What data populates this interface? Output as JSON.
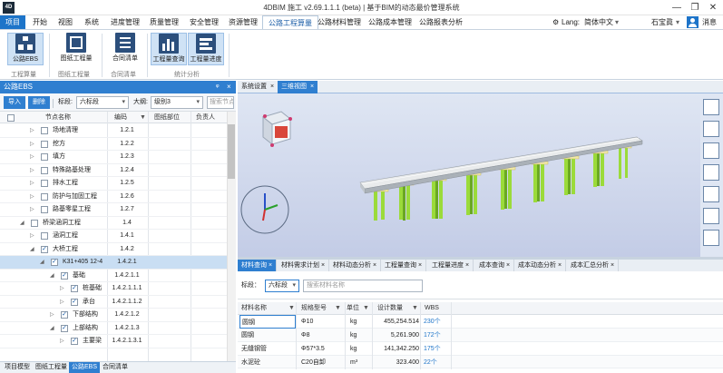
{
  "titlebar": {
    "app_icon_text": "4D",
    "title": "4DBIM 施工 v2.69.1.1.1  (beta)  |  基于BIM的动态最价管理系统",
    "min": "—",
    "max": "❐",
    "close": "✕"
  },
  "menu": {
    "items": [
      "项目",
      "开始",
      "视图",
      "系统",
      "进度管理",
      "质量管理",
      "安全管理",
      "资源管理",
      "公路工程算量",
      "公路材料管理",
      "公路成本管理",
      "公路报表分析"
    ],
    "lang_label": "Lang:",
    "lang_value": "简体中文",
    "user": "石宝眞",
    "message": "消息"
  },
  "ribbon": {
    "buttons": [
      "公路EBS",
      "图纸工程量",
      "合同清单",
      "工程量查询",
      "工程量进度"
    ],
    "groups": [
      "工程算量",
      "图纸工程量",
      "合同清单",
      "统计分析"
    ]
  },
  "left_panel": {
    "title": "公路EBS",
    "import": "导入",
    "delete": "删除",
    "section_label": "标段:",
    "section_value": "六标段",
    "level_label": "大纲:",
    "level_value": "级别3",
    "search_placeholder": "搜索节点",
    "columns": [
      "节点名称",
      "编码",
      "图纸部位",
      "负责人"
    ],
    "rows": [
      {
        "name": "场地清理",
        "code": "1.2.1"
      },
      {
        "name": "挖方",
        "code": "1.2.2"
      },
      {
        "name": "填方",
        "code": "1.2.3"
      },
      {
        "name": "特殊路基处理",
        "code": "1.2.4"
      },
      {
        "name": "排水工程",
        "code": "1.2.5"
      },
      {
        "name": "防护与加固工程",
        "code": "1.2.6"
      },
      {
        "name": "路基零星工程",
        "code": "1.2.7"
      },
      {
        "name": "桥梁涵洞工程",
        "code": "1.4"
      },
      {
        "name": "涵洞工程",
        "code": "1.4.1"
      },
      {
        "name": "大桥工程",
        "code": "1.4.2"
      },
      {
        "name": "K31+405 12-4",
        "code": "1.4.2.1"
      },
      {
        "name": "基础",
        "code": "1.4.2.1.1"
      },
      {
        "name": "桩基础",
        "code": "1.4.2.1.1.1"
      },
      {
        "name": "承台",
        "code": "1.4.2.1.1.2"
      },
      {
        "name": "下部结构",
        "code": "1.4.2.1.2"
      },
      {
        "name": "上部结构",
        "code": "1.4.2.1.3"
      },
      {
        "name": "主要梁",
        "code": "1.4.2.1.3.1"
      }
    ]
  },
  "bottom_tabs": [
    "项目模型",
    "图纸工程量",
    "公路EBS",
    "合同清单"
  ],
  "view_tabs": [
    "系统设置",
    "三维视图"
  ],
  "viewcube_face": "后",
  "material": {
    "tabs": [
      "材料查询",
      "材料需求计划",
      "材料动态分析",
      "工程量查询",
      "工程量进度",
      "成本查询",
      "成本动态分析",
      "成本汇总分析"
    ],
    "section_label": "标段：",
    "section_value": "六标段",
    "search_placeholder": "搜索材料名称",
    "columns": [
      "材料名称",
      "规格型号",
      "单位",
      "设计数量",
      "WBS"
    ],
    "rows": [
      {
        "name": "圆钢",
        "spec": "Φ10",
        "unit": "kg",
        "qty": "455,254.514",
        "wbs": "230个"
      },
      {
        "name": "圆钢",
        "spec": "Φ8",
        "unit": "kg",
        "qty": "5,261.900",
        "wbs": "172个"
      },
      {
        "name": "无缝钢管",
        "spec": "Φ57*3.5",
        "unit": "kg",
        "qty": "141,342.250",
        "wbs": "175个"
      },
      {
        "name": "水泥砼",
        "spec": "C20自卸",
        "unit": "m³",
        "qty": "323.400",
        "wbs": "22个"
      }
    ]
  }
}
